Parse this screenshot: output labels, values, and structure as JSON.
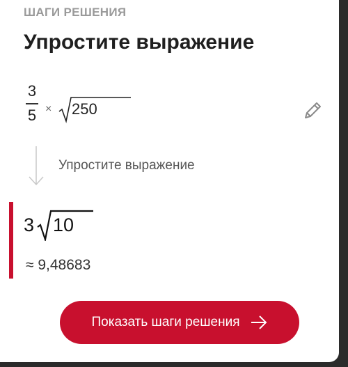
{
  "header": {
    "section_label": "ШАГИ РЕШЕНИЯ",
    "title": "Упростите выражение"
  },
  "expression": {
    "numerator": "3",
    "denominator": "5",
    "operator": "×",
    "radicand": "250"
  },
  "step": {
    "description": "Упростите выражение"
  },
  "result": {
    "coefficient": "3",
    "radicand": "10",
    "approximation": "≈ 9,48683"
  },
  "cta": {
    "label": "Показать шаги решения"
  },
  "icons": {
    "edit": "pencil-icon",
    "step_arrow": "arrow-down-icon",
    "cta_arrow": "arrow-right-icon"
  },
  "colors": {
    "accent": "#c8102e",
    "muted_text": "#9a9a9a",
    "text": "#1f1f1f"
  }
}
